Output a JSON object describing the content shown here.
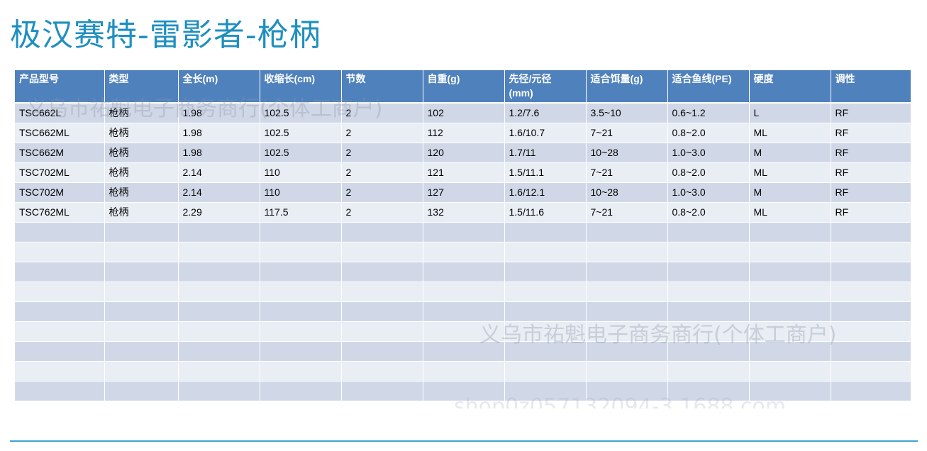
{
  "title": "极汉赛特-雷影者-枪柄",
  "table": {
    "headers": [
      "产品型号",
      "类型",
      "全长(m)",
      "收缩长(cm)",
      "节数",
      "自重(g)",
      "先径/元径\n(mm)",
      "适合饵量(g)",
      "适合鱼线(PE)",
      "硬度",
      "调性"
    ],
    "rows": [
      [
        "TSC662L",
        "枪柄",
        "1.98",
        "102.5",
        "2",
        "102",
        "1.2/7.6",
        "3.5~10",
        "0.6~1.2",
        "L",
        "RF"
      ],
      [
        "TSC662ML",
        "枪柄",
        "1.98",
        "102.5",
        "2",
        "112",
        "1.6/10.7",
        "7~21",
        "0.8~2.0",
        "ML",
        "RF"
      ],
      [
        "TSC662M",
        "枪柄",
        "1.98",
        "102.5",
        "2",
        "120",
        "1.7/11",
        "10~28",
        "1.0~3.0",
        "M",
        "RF"
      ],
      [
        "TSC702ML",
        "枪柄",
        "2.14",
        "110",
        "2",
        "121",
        "1.5/11.1",
        "7~21",
        "0.8~2.0",
        "ML",
        "RF"
      ],
      [
        "TSC702M",
        "枪柄",
        "2.14",
        "110",
        "2",
        "127",
        "1.6/12.1",
        "10~28",
        "1.0~3.0",
        "M",
        "RF"
      ],
      [
        "TSC762ML",
        "枪柄",
        "2.29",
        "117.5",
        "2",
        "132",
        "1.5/11.6",
        "7~21",
        "0.8~2.0",
        "ML",
        "RF"
      ]
    ],
    "empty_rows": 9
  },
  "watermarks": {
    "top": "义乌市祐魁电子商务商行(个体工商户)",
    "middle": "义乌市祐魁电子商务商行(个体工商户)",
    "bottom": "shop0z057132094-3.1688.com"
  },
  "colors": {
    "title": "#1e8fc0",
    "header_bg": "#4f81bd",
    "row_odd": "#d0d8e8",
    "row_even": "#e9edf4",
    "rule": "#3fa4cf"
  }
}
